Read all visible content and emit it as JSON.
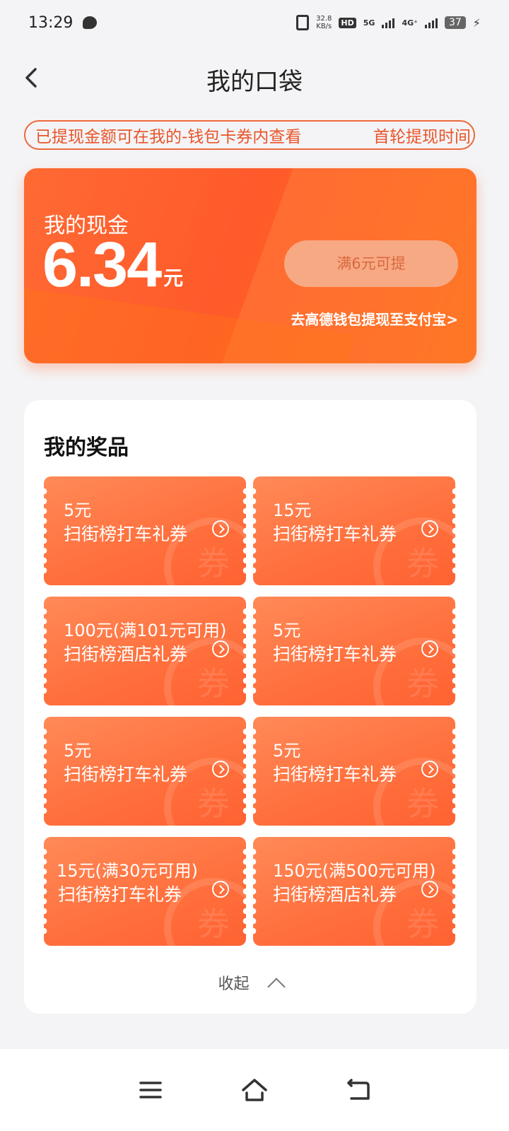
{
  "status_bar": {
    "time": "13:29",
    "net_speed_value": "32.8",
    "net_speed_unit": "KB/s",
    "hd_label": "HD",
    "net_5g": "5G",
    "net_4g": "4G⁺",
    "battery": "37"
  },
  "header": {
    "title": "我的口袋"
  },
  "notice": {
    "left_text": "已提现金额可在我的-钱包卡券内查看",
    "right_text": "首轮提现时间"
  },
  "cash": {
    "label": "我的现金",
    "amount": "6.34",
    "unit": "元",
    "withdraw_button": "满6元可提",
    "wallet_link": "去高德钱包提现至支付宝>"
  },
  "prizes": {
    "title": "我的奖品",
    "coupons": [
      {
        "amount": "5元",
        "name": "扫街榜打车礼券"
      },
      {
        "amount": "15元",
        "name": "扫街榜打车礼券"
      },
      {
        "amount": "100元(满101元可用)",
        "name": "扫街榜酒店礼券"
      },
      {
        "amount": "5元",
        "name": "扫街榜打车礼券"
      },
      {
        "amount": "5元",
        "name": "扫街榜打车礼券"
      },
      {
        "amount": "5元",
        "name": "扫街榜打车礼券"
      },
      {
        "amount": "15元(满30元可用)",
        "name": "扫街榜打车礼券"
      },
      {
        "amount": "150元(满500元可用)",
        "name": "扫街榜酒店礼券"
      }
    ],
    "watermark": "券",
    "collapse_label": "收起"
  },
  "icons": {
    "back": "chevron-left-icon",
    "coupon_arrow": "circle-arrow-right-icon",
    "collapse": "chevron-up-icon",
    "nav_menu": "menu-icon",
    "nav_home": "home-icon",
    "nav_back": "back-icon"
  },
  "colors": {
    "accent": "#ff6a33",
    "notice_text": "#e9552a",
    "withdraw_button_bg": "#f7a984"
  }
}
